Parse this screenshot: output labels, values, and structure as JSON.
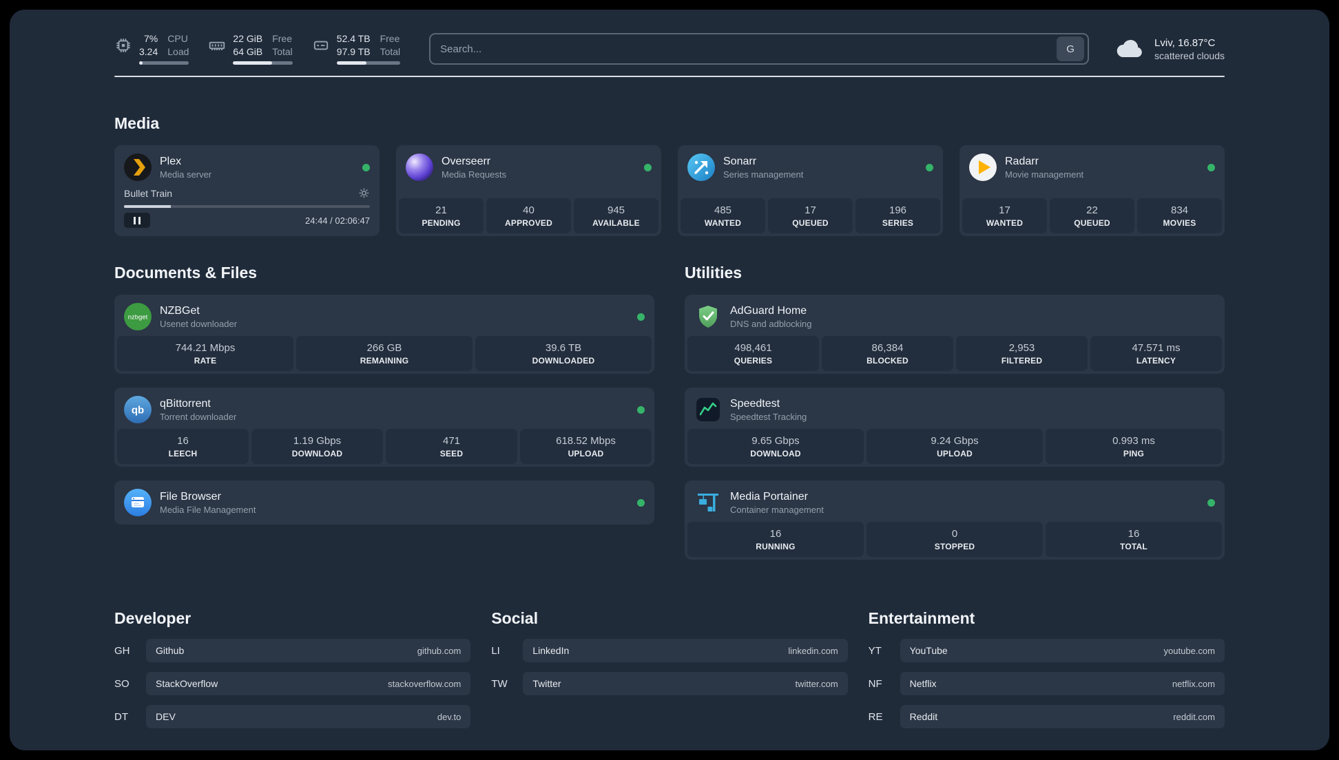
{
  "topbar": {
    "cpu": {
      "percent": "7%",
      "load_value": "3.24",
      "label_top": "CPU",
      "label_bottom": "Load",
      "bar_fill": 7
    },
    "memory": {
      "free": "22 GiB",
      "total": "64 GiB",
      "label_top": "Free",
      "label_bottom": "Total",
      "bar_fill": 66
    },
    "disk": {
      "free": "52.4 TB",
      "total": "97.9 TB",
      "label_top": "Free",
      "label_bottom": "Total",
      "bar_fill": 47
    },
    "search": {
      "placeholder": "Search...",
      "button_label": "G"
    },
    "weather": {
      "location": "Lviv, 16.87°C",
      "condition": "scattered clouds"
    }
  },
  "media": {
    "title": "Media",
    "plex": {
      "name": "Plex",
      "subtitle": "Media server",
      "now_playing": "Bullet Train",
      "time": "24:44 / 02:06:47",
      "progress": 19
    },
    "overseerr": {
      "name": "Overseerr",
      "subtitle": "Media Requests",
      "stats": [
        {
          "value": "21",
          "label": "PENDING"
        },
        {
          "value": "40",
          "label": "APPROVED"
        },
        {
          "value": "945",
          "label": "AVAILABLE"
        }
      ]
    },
    "sonarr": {
      "name": "Sonarr",
      "subtitle": "Series management",
      "stats": [
        {
          "value": "485",
          "label": "WANTED"
        },
        {
          "value": "17",
          "label": "QUEUED"
        },
        {
          "value": "196",
          "label": "SERIES"
        }
      ]
    },
    "radarr": {
      "name": "Radarr",
      "subtitle": "Movie management",
      "stats": [
        {
          "value": "17",
          "label": "WANTED"
        },
        {
          "value": "22",
          "label": "QUEUED"
        },
        {
          "value": "834",
          "label": "MOVIES"
        }
      ]
    }
  },
  "docs": {
    "title": "Documents & Files",
    "nzbget": {
      "name": "NZBGet",
      "subtitle": "Usenet downloader",
      "stats": [
        {
          "value": "744.21 Mbps",
          "label": "RATE"
        },
        {
          "value": "266 GB",
          "label": "REMAINING"
        },
        {
          "value": "39.6 TB",
          "label": "DOWNLOADED"
        }
      ]
    },
    "qbittorrent": {
      "name": "qBittorrent",
      "subtitle": "Torrent downloader",
      "stats": [
        {
          "value": "16",
          "label": "LEECH"
        },
        {
          "value": "1.19 Gbps",
          "label": "DOWNLOAD"
        },
        {
          "value": "471",
          "label": "SEED"
        },
        {
          "value": "618.52 Mbps",
          "label": "UPLOAD"
        }
      ]
    },
    "filebrowser": {
      "name": "File Browser",
      "subtitle": "Media File Management"
    }
  },
  "utils": {
    "title": "Utilities",
    "adguard": {
      "name": "AdGuard Home",
      "subtitle": "DNS and adblocking",
      "stats": [
        {
          "value": "498,461",
          "label": "QUERIES"
        },
        {
          "value": "86,384",
          "label": "BLOCKED"
        },
        {
          "value": "2,953",
          "label": "FILTERED"
        },
        {
          "value": "47.571 ms",
          "label": "LATENCY"
        }
      ]
    },
    "speedtest": {
      "name": "Speedtest",
      "subtitle": "Speedtest Tracking",
      "stats": [
        {
          "value": "9.65 Gbps",
          "label": "DOWNLOAD"
        },
        {
          "value": "9.24 Gbps",
          "label": "UPLOAD"
        },
        {
          "value": "0.993 ms",
          "label": "PING"
        }
      ]
    },
    "portainer": {
      "name": "Media Portainer",
      "subtitle": "Container management",
      "stats": [
        {
          "value": "16",
          "label": "RUNNING"
        },
        {
          "value": "0",
          "label": "STOPPED"
        },
        {
          "value": "16",
          "label": "TOTAL"
        }
      ]
    }
  },
  "bookmarks": {
    "developer": {
      "title": "Developer",
      "items": [
        {
          "abbr": "GH",
          "name": "Github",
          "url": "github.com"
        },
        {
          "abbr": "SO",
          "name": "StackOverflow",
          "url": "stackoverflow.com"
        },
        {
          "abbr": "DT",
          "name": "DEV",
          "url": "dev.to"
        }
      ]
    },
    "social": {
      "title": "Social",
      "items": [
        {
          "abbr": "LI",
          "name": "LinkedIn",
          "url": "linkedin.com"
        },
        {
          "abbr": "TW",
          "name": "Twitter",
          "url": "twitter.com"
        }
      ]
    },
    "entertainment": {
      "title": "Entertainment",
      "items": [
        {
          "abbr": "YT",
          "name": "YouTube",
          "url": "youtube.com"
        },
        {
          "abbr": "NF",
          "name": "Netflix",
          "url": "netflix.com"
        },
        {
          "abbr": "RE",
          "name": "Reddit",
          "url": "reddit.com"
        }
      ]
    }
  }
}
